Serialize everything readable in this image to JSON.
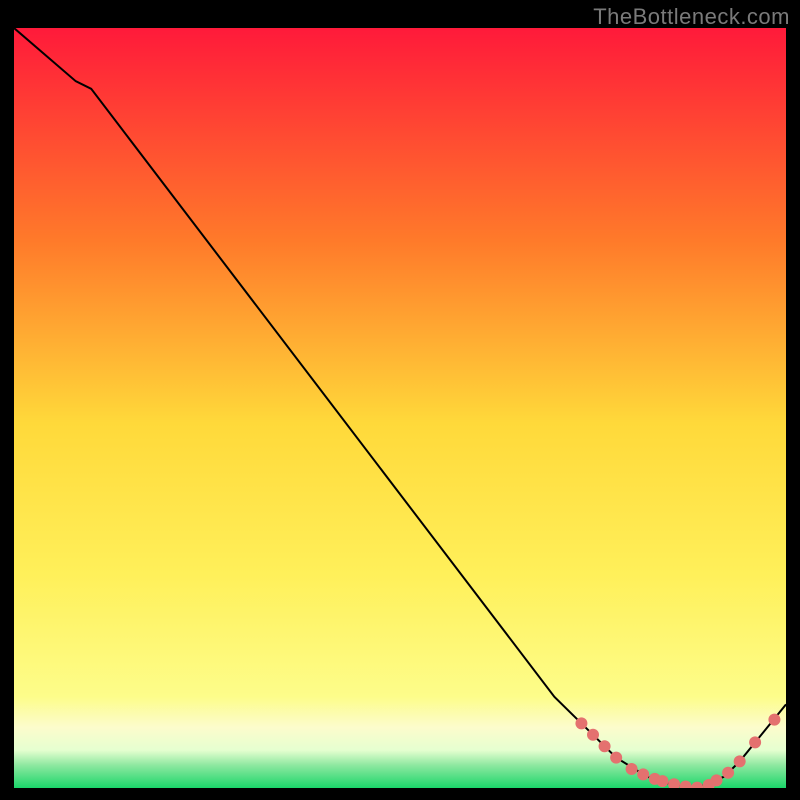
{
  "watermark": "TheBottleneck.com",
  "colors": {
    "bg_black": "#000000",
    "curve": "#000000",
    "dot_fill": "#e4716f",
    "grad_top": "#ff1a3a",
    "grad_mid_upper": "#ff8a2a",
    "grad_mid": "#ffe03a",
    "grad_mid_lower": "#fff6a0",
    "grad_pale": "#e6ffd0",
    "grad_green": "#1bd66a"
  },
  "chart_data": {
    "type": "line",
    "title": "",
    "xlabel": "",
    "ylabel": "",
    "x_range": [
      0,
      100
    ],
    "y_range": [
      0,
      100
    ],
    "curve": [
      [
        0,
        100
      ],
      [
        8,
        93
      ],
      [
        10,
        92
      ],
      [
        70,
        12
      ],
      [
        74,
        8
      ],
      [
        78,
        4
      ],
      [
        82,
        1.5
      ],
      [
        85,
        0.5
      ],
      [
        88.5,
        0
      ],
      [
        92,
        1.5
      ],
      [
        94,
        3.5
      ],
      [
        96,
        6
      ],
      [
        98,
        8.5
      ],
      [
        100,
        11
      ]
    ],
    "dots": [
      [
        73.5,
        8.5
      ],
      [
        75,
        7
      ],
      [
        76.5,
        5.5
      ],
      [
        78,
        4
      ],
      [
        80,
        2.5
      ],
      [
        81.5,
        1.8
      ],
      [
        83,
        1.2
      ],
      [
        84,
        0.9
      ],
      [
        85.5,
        0.5
      ],
      [
        87,
        0.2
      ],
      [
        88.5,
        0.05
      ],
      [
        90,
        0.4
      ],
      [
        91,
        1
      ],
      [
        92.5,
        2
      ],
      [
        94,
        3.5
      ],
      [
        96,
        6
      ],
      [
        98.5,
        9
      ]
    ],
    "gradient_bands": [
      {
        "from_y": 100,
        "to_y": 9.0,
        "stops": [
          [
            0,
            "#ff1a3a"
          ],
          [
            0.35,
            "#ff8a2a"
          ],
          [
            0.58,
            "#ffe03a"
          ],
          [
            0.78,
            "#fff05a"
          ],
          [
            1,
            "#fdfd8a"
          ]
        ]
      },
      {
        "from_y": 9.0,
        "to_y": 4.0,
        "color": "#fcfccc"
      },
      {
        "from_y": 4.0,
        "to_y": 2.0,
        "color": "#e6ffd0"
      },
      {
        "from_y": 2.0,
        "to_y": 0.0,
        "color": "#1bd66a"
      }
    ]
  }
}
